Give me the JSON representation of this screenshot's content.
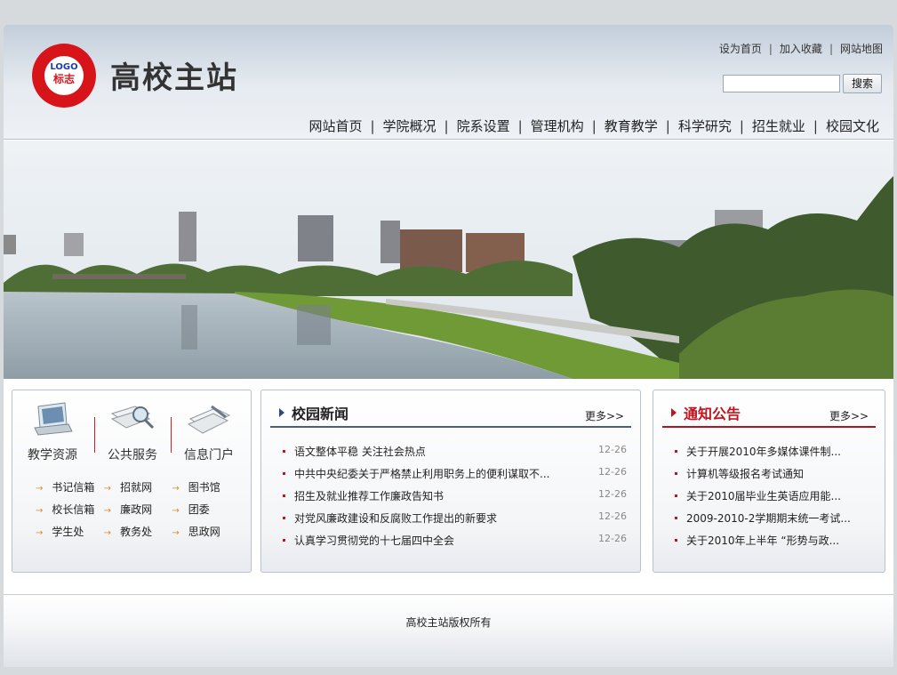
{
  "header": {
    "logo_text": "LOGO",
    "logo_cn": "标志",
    "site_title": "高校主站",
    "top_links": [
      "设为首页",
      "加入收藏",
      "网站地图"
    ],
    "search_button": "搜索",
    "search_value": ""
  },
  "nav": [
    "网站首页",
    "学院概况",
    "院系设置",
    "管理机构",
    "教育教学",
    "科学研究",
    "招生就业",
    "校园文化"
  ],
  "services": {
    "icons": [
      {
        "label": "教学资源",
        "icon": "laptop-icon"
      },
      {
        "label": "公共服务",
        "icon": "magnifier-icon"
      },
      {
        "label": "信息门户",
        "icon": "documents-icon"
      }
    ],
    "links": [
      [
        "书记信箱",
        "招就网",
        "图书馆"
      ],
      [
        "校长信箱",
        "廉政网",
        "团委"
      ],
      [
        "学生处",
        "教务处",
        "思政网"
      ]
    ]
  },
  "campus_news": {
    "title": "校园新闻",
    "more": "更多>>",
    "items": [
      {
        "title": "语文整体平稳 关注社会热点",
        "date": "12-26"
      },
      {
        "title": "中共中央纪委关于严格禁止利用职务上的便利谋取不...",
        "date": "12-26"
      },
      {
        "title": "招生及就业推荐工作廉政告知书",
        "date": "12-26"
      },
      {
        "title": "对党风廉政建设和反腐败工作提出的新要求",
        "date": "12-26"
      },
      {
        "title": "认真学习贯彻党的十七届四中全会",
        "date": "12-26"
      }
    ]
  },
  "notices": {
    "title": "通知公告",
    "more": "更多>>",
    "items": [
      "关于开展2010年多媒体课件制...",
      "计算机等级报名考试通知",
      "关于2010届毕业生英语应用能...",
      "2009-2010-2学期期末统一考试...",
      "关于2010年上半年 “形势与政..."
    ]
  },
  "footer": {
    "copyright": "高校主站版权所有"
  },
  "colors": {
    "accent_red": "#c1141c",
    "nav_blue": "#2f4a7a",
    "header_bg": "#c3cedb"
  }
}
